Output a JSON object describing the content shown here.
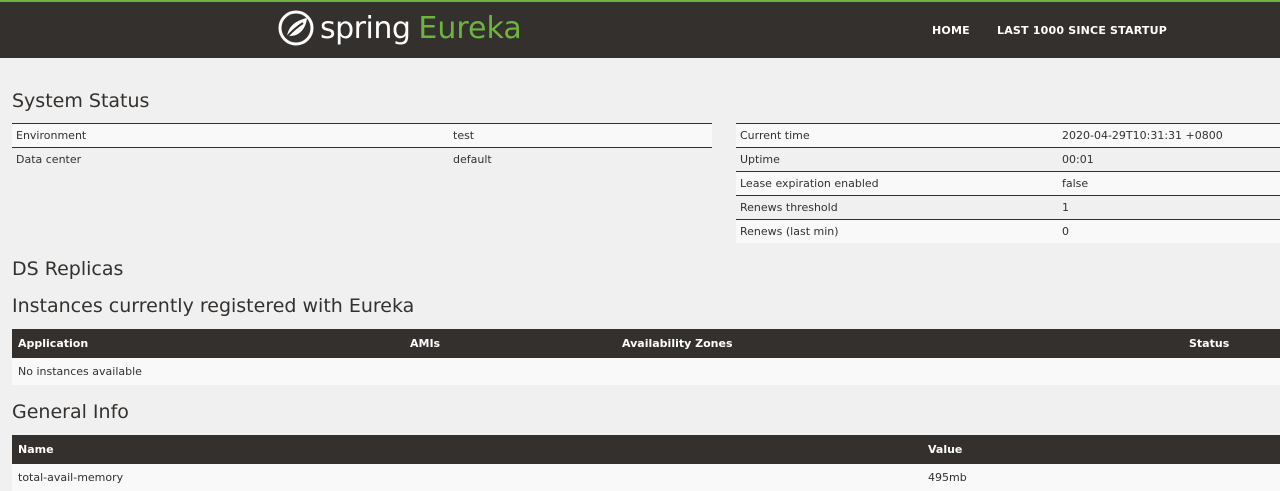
{
  "nav": {
    "brand_spring": "spring",
    "brand_eureka": "Eureka",
    "home": "HOME",
    "last1000": "LAST 1000 SINCE STARTUP"
  },
  "system_status": {
    "title": "System Status",
    "left": [
      {
        "label": "Environment",
        "value": "test"
      },
      {
        "label": "Data center",
        "value": "default"
      }
    ],
    "right": [
      {
        "label": "Current time",
        "value": "2020-04-29T10:31:31 +0800"
      },
      {
        "label": "Uptime",
        "value": "00:01"
      },
      {
        "label": "Lease expiration enabled",
        "value": "false"
      },
      {
        "label": "Renews threshold",
        "value": "1"
      },
      {
        "label": "Renews (last min)",
        "value": "0"
      }
    ]
  },
  "ds_replicas": {
    "title": "DS Replicas"
  },
  "instances": {
    "title": "Instances currently registered with Eureka",
    "columns": [
      "Application",
      "AMIs",
      "Availability Zones",
      "Status"
    ],
    "empty": "No instances available"
  },
  "general_info": {
    "title": "General Info",
    "columns": [
      "Name",
      "Value"
    ],
    "rows": [
      {
        "name": "total-avail-memory",
        "value": "495mb"
      }
    ]
  },
  "colors": {
    "brand_green": "#6db33f",
    "dark": "#34302d",
    "background": "#f0f0f0"
  }
}
